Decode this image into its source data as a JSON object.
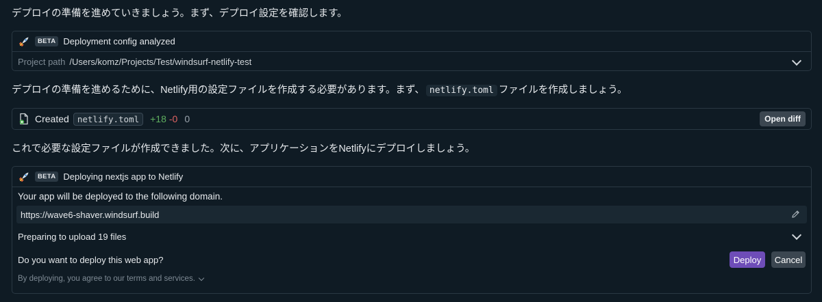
{
  "messages": {
    "intro": "デプロイの準備を進めていきましょう。まず、デプロイ設定を確認します。",
    "need_config_before": "デプロイの準備を進めるために、Netlify用の設定ファイルを作成する必要があります。まず、",
    "need_config_code": "netlify.toml",
    "need_config_after": "ファイルを作成しましょう。",
    "created_done": "これで必要な設定ファイルが作成できました。次に、アプリケーションをNetlifyにデプロイしましょう。"
  },
  "config_card": {
    "badge": "BETA",
    "title": "Deployment config analyzed",
    "path_label": "Project path",
    "path_value": "/Users/komz/Projects/Test/windsurf-netlify-test"
  },
  "file_card": {
    "created_label": "Created",
    "filename": "netlify.toml",
    "additions": "+18",
    "deletions": "-0",
    "unchanged": "0",
    "open_diff_label": "Open diff"
  },
  "deploy_card": {
    "badge": "BETA",
    "title": "Deploying nextjs app to Netlify",
    "domain_intro": "Your app will be deployed to the following domain.",
    "domain_url": "https://wave6-shaver.windsurf.build",
    "upload_status": "Preparing to upload 19 files",
    "question": "Do you want to deploy this web app?",
    "deploy_label": "Deploy",
    "cancel_label": "Cancel",
    "terms": "By deploying, you agree to our terms and services."
  },
  "icons": {
    "rocket": "rocket-icon",
    "file_created": "file-created-icon",
    "chevron": "chevron-down-icon",
    "edit": "pencil-icon"
  },
  "colors": {
    "additions": "#5fae5f",
    "deletions": "#e06363",
    "deploy_button": "#6e4db8",
    "background": "#0f1b24"
  }
}
